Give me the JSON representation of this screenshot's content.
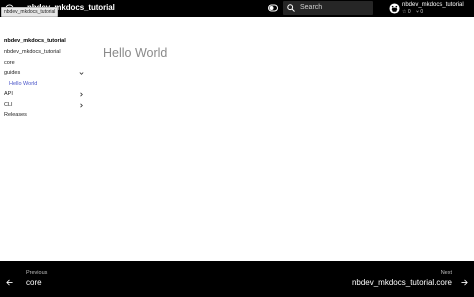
{
  "header": {
    "site_title": "nbdev_mkdocs_tutorial",
    "tooltip": "nbdev_mkdocs_tutorial",
    "logo_icon": "book-icon",
    "palette_icon": "toggle-icon",
    "search": {
      "placeholder": "Search",
      "icon": "search-icon"
    },
    "repo": {
      "icon": "github-icon",
      "name": "nbdev_mkdocs_tutorial",
      "stars": "☆ 0",
      "forks": "⑂ 0"
    }
  },
  "sidebar": {
    "title": "nbdev_mkdocs_tutorial",
    "items": [
      {
        "label": "nbdev_mkdocs_tutorial"
      },
      {
        "label": "core"
      },
      {
        "label": "guides",
        "chevron": "chevron-down-icon"
      },
      {
        "label": "Hello World",
        "active": true
      },
      {
        "label": "API",
        "chevron": "chevron-right-icon"
      },
      {
        "label": "CLI",
        "chevron": "chevron-right-icon"
      },
      {
        "label": "Releases"
      }
    ]
  },
  "content": {
    "heading": "Hello World"
  },
  "footer": {
    "previous": {
      "direction": "Previous",
      "title": "core"
    },
    "next": {
      "direction": "Next",
      "title": "nbdev_mkdocs_tutorial.core"
    }
  },
  "colors": {
    "header_bg": "#000000",
    "active_link": "#4a55c9",
    "footer_bg": "#000000"
  }
}
